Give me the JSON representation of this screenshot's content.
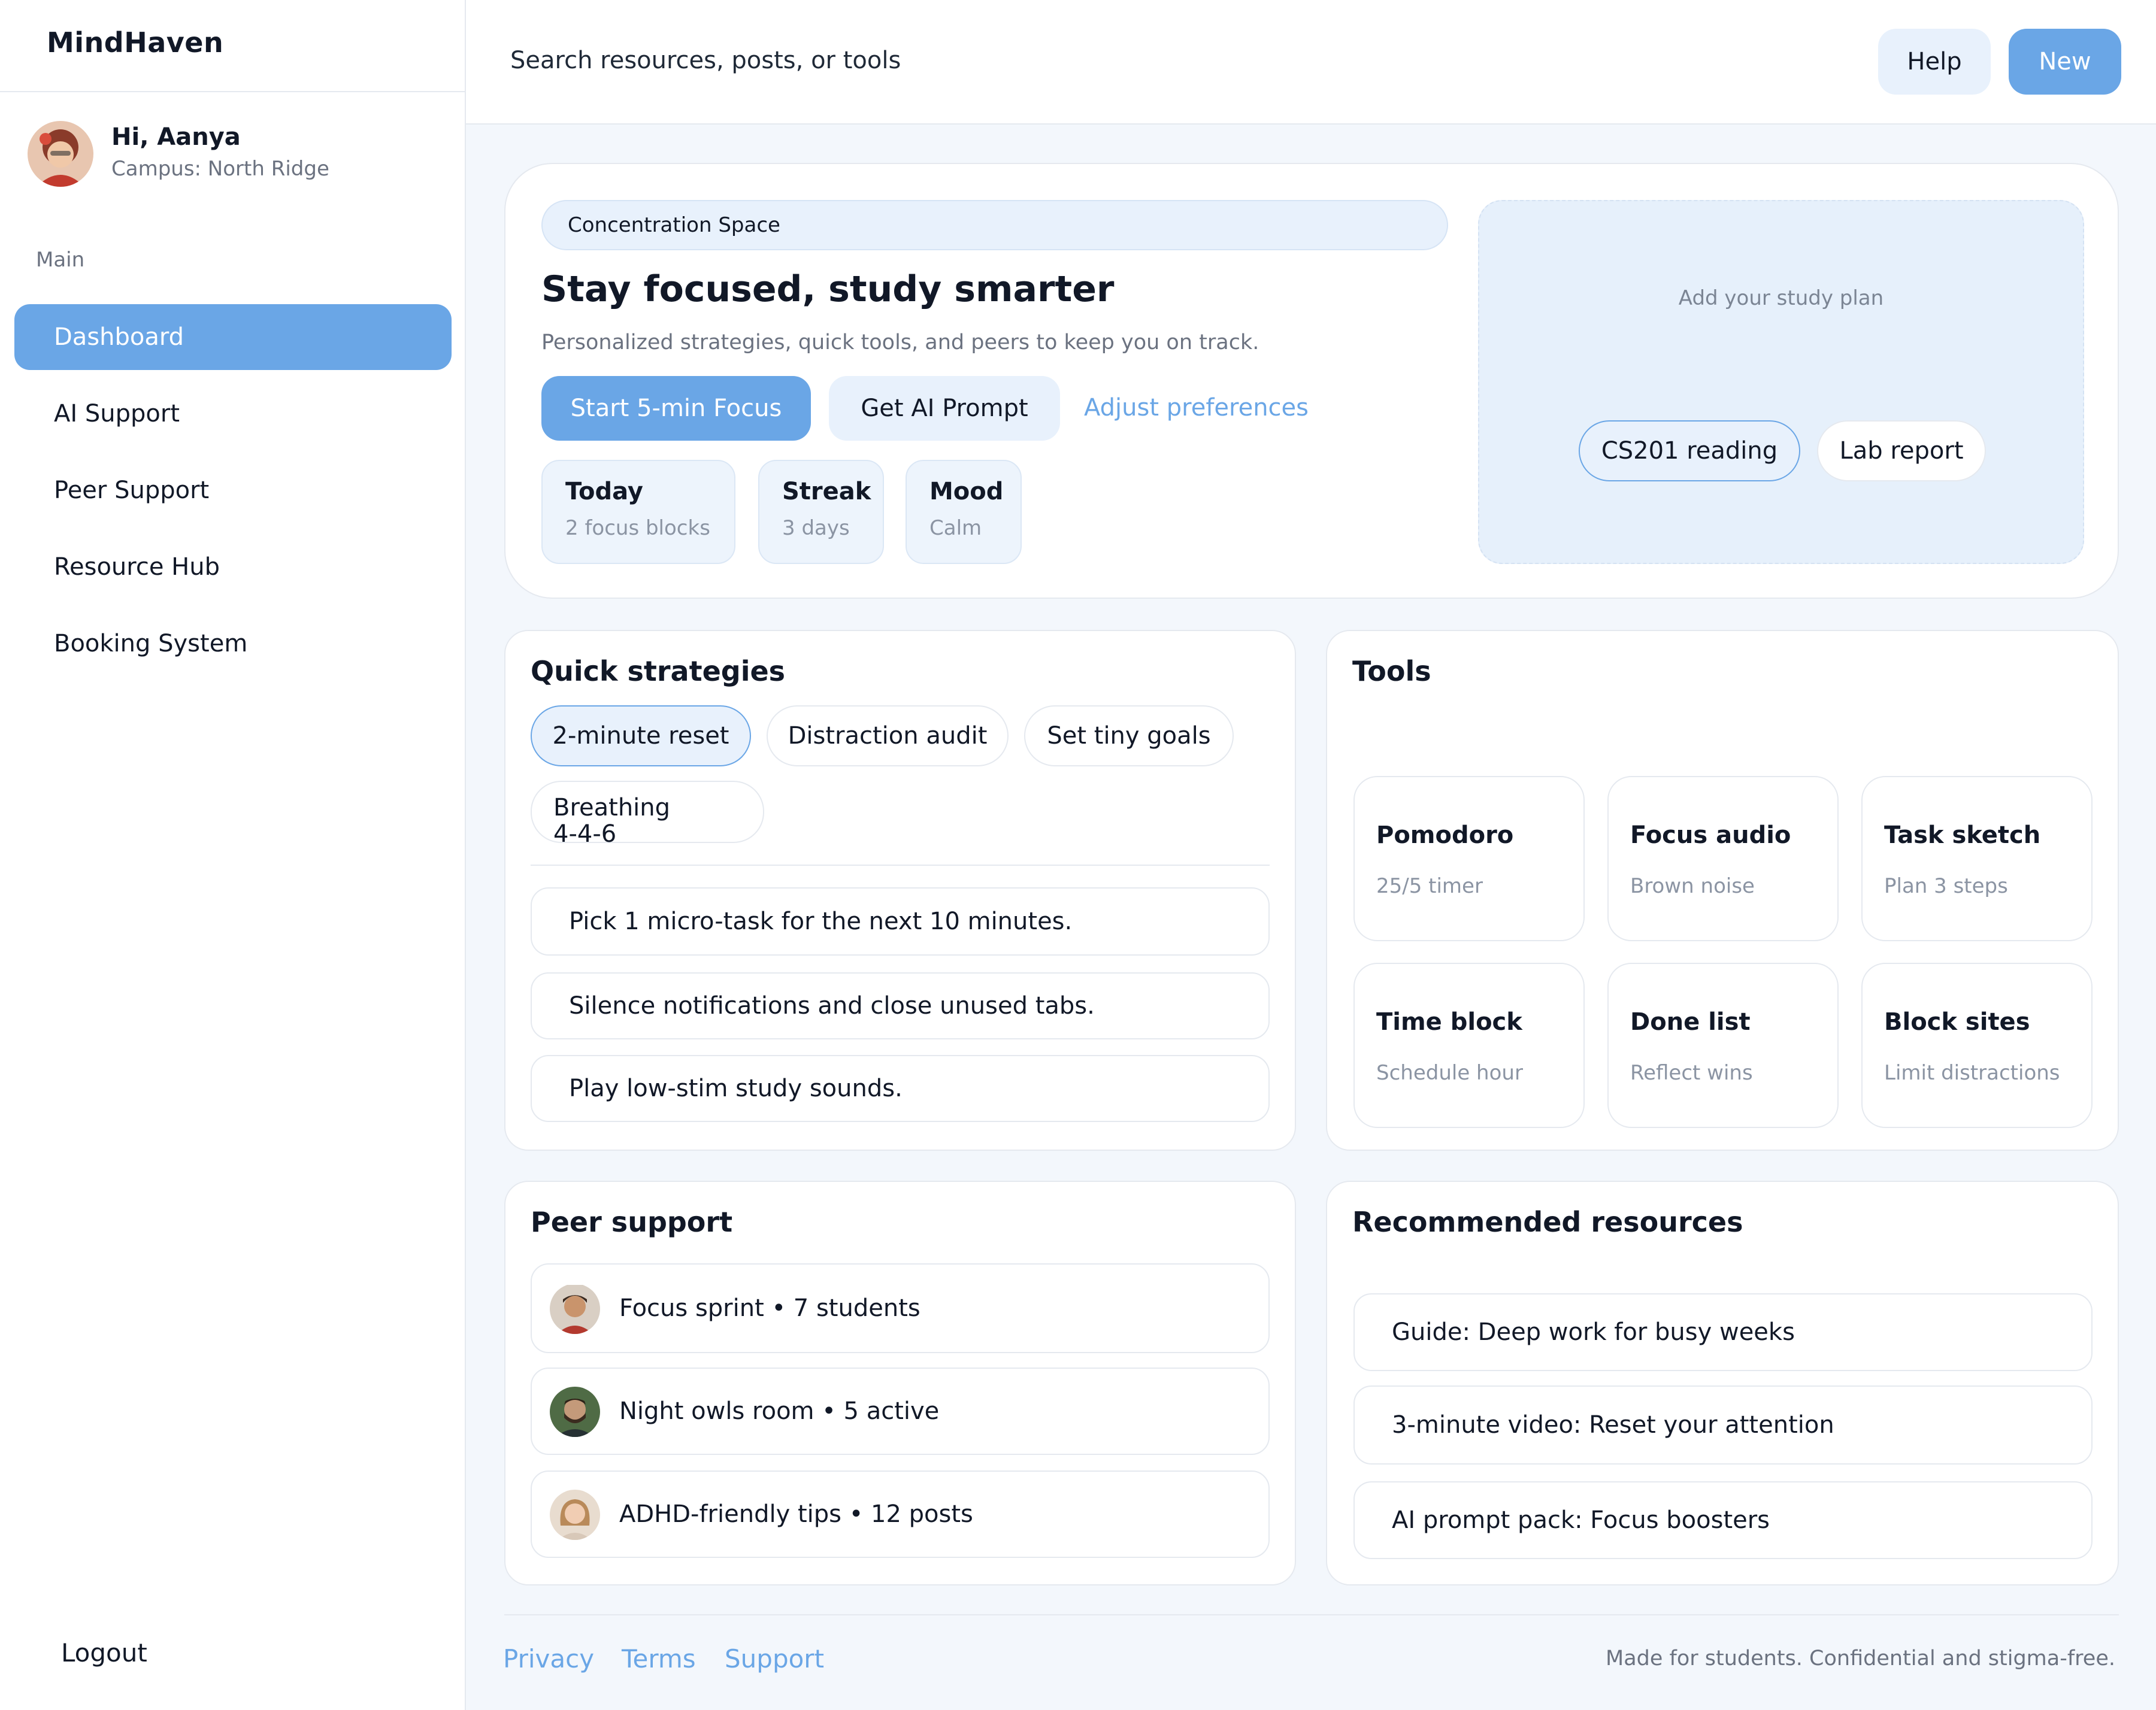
{
  "brand": "MindHaven",
  "user": {
    "greeting": "Hi, Aanya",
    "campus": "Campus: North Ridge"
  },
  "sidebar": {
    "section": "Main",
    "items": [
      {
        "label": "Dashboard",
        "active": true
      },
      {
        "label": "AI Support"
      },
      {
        "label": "Peer Support"
      },
      {
        "label": "Resource Hub"
      },
      {
        "label": "Booking System"
      }
    ],
    "logout": "Logout"
  },
  "topbar": {
    "search_placeholder": "Search resources, posts, or tools",
    "help": "Help",
    "new": "New"
  },
  "hero": {
    "tag": "Concentration Space",
    "title": "Stay focused, study smarter",
    "subtitle": "Personalized strategies, quick tools, and peers to keep you on track.",
    "primary_btn": "Start 5-min Focus",
    "secondary_btn": "Get AI Prompt",
    "link": "Adjust preferences",
    "stats": [
      {
        "title": "Today",
        "sub": "2 focus blocks"
      },
      {
        "title": "Streak",
        "sub": "3 days"
      },
      {
        "title": "Mood",
        "sub": "Calm"
      }
    ],
    "plan": {
      "prompt": "Add your study plan",
      "chips": [
        "CS201 reading",
        "Lab report"
      ]
    }
  },
  "strategies": {
    "title": "Quick strategies",
    "chips": [
      "2-minute reset",
      "Distraction audit",
      "Set tiny goals",
      "Breathing",
      "4-4-6"
    ],
    "items": [
      "Pick 1 micro-task for the next 10 minutes.",
      "Silence notifications and close unused tabs.",
      "Play low-stim study sounds."
    ]
  },
  "tools": {
    "title": "Tools",
    "items": [
      {
        "title": "Pomodoro",
        "sub": "25/5 timer"
      },
      {
        "title": "Focus audio",
        "sub": "Brown noise"
      },
      {
        "title": "Task sketch",
        "sub": "Plan 3 steps"
      },
      {
        "title": "Time block",
        "sub": "Schedule hour"
      },
      {
        "title": "Done list",
        "sub": "Reflect wins"
      },
      {
        "title": "Block sites",
        "sub": "Limit distractions"
      }
    ]
  },
  "peer": {
    "title": "Peer support",
    "items": [
      {
        "text": "Focus sprint • 7 students"
      },
      {
        "text": "Night owls room • 5 active"
      },
      {
        "text": "ADHD-friendly tips • 12 posts"
      }
    ]
  },
  "resources": {
    "title": "Recommended resources",
    "items": [
      "Guide: Deep work for busy weeks",
      "3-minute video: Reset your attention",
      "AI prompt pack: Focus boosters"
    ]
  },
  "footer": {
    "links": [
      "Privacy",
      "Terms",
      "Support"
    ],
    "note": "Made for students. Confidential and stigma-free."
  },
  "colors": {
    "accent": "#6aa6e6",
    "accent_light": "#e8f1fc",
    "bg": "#f3f7fc"
  }
}
